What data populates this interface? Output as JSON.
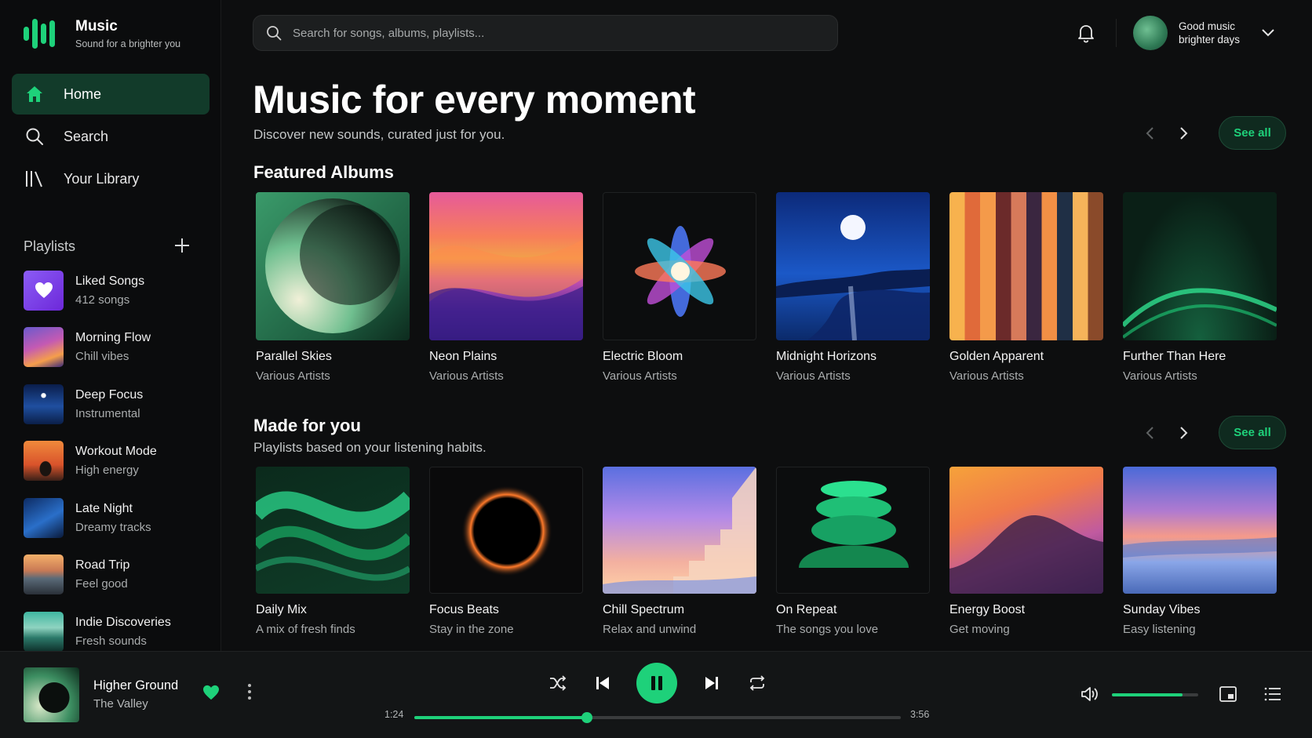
{
  "brand": {
    "name": "Music",
    "tagline": "Sound for a brighter you",
    "accent": "#1ed17a"
  },
  "nav": {
    "items": [
      {
        "label": "Home",
        "icon": "home-icon",
        "active": true
      },
      {
        "label": "Search",
        "icon": "search-icon",
        "active": false
      },
      {
        "label": "Your Library",
        "icon": "library-icon",
        "active": false
      }
    ]
  },
  "playlists": {
    "title": "Playlists",
    "items": [
      {
        "name": "Liked Songs",
        "sub": "412 songs"
      },
      {
        "name": "Morning Flow",
        "sub": "Chill vibes"
      },
      {
        "name": "Deep Focus",
        "sub": "Instrumental"
      },
      {
        "name": "Workout Mode",
        "sub": "High energy"
      },
      {
        "name": "Late Night",
        "sub": "Dreamy tracks"
      },
      {
        "name": "Road Trip",
        "sub": "Feel good"
      },
      {
        "name": "Indie Discoveries",
        "sub": "Fresh sounds"
      }
    ]
  },
  "search": {
    "placeholder": "Search for songs, albums, playlists..."
  },
  "user": {
    "line1": "Good music",
    "line2": "brighter days"
  },
  "hero": {
    "title": "Music for every moment",
    "subtitle": "Discover new sounds, curated just for you."
  },
  "featured": {
    "title": "Featured Albums",
    "see_all": "See all",
    "items": [
      {
        "title": "Parallel Skies",
        "sub": "Various Artists"
      },
      {
        "title": "Neon Plains",
        "sub": "Various Artists"
      },
      {
        "title": "Electric Bloom",
        "sub": "Various Artists"
      },
      {
        "title": "Midnight Horizons",
        "sub": "Various Artists"
      },
      {
        "title": "Golden Apparent",
        "sub": "Various Artists"
      },
      {
        "title": "Further Than Here",
        "sub": "Various Artists"
      }
    ]
  },
  "made_for_you": {
    "title": "Made for you",
    "subtitle": "Playlists based on your listening habits.",
    "see_all": "See all",
    "items": [
      {
        "title": "Daily Mix",
        "sub": "A mix of fresh finds"
      },
      {
        "title": "Focus Beats",
        "sub": "Stay in the zone"
      },
      {
        "title": "Chill Spectrum",
        "sub": "Relax and unwind"
      },
      {
        "title": "On Repeat",
        "sub": "The songs you love"
      },
      {
        "title": "Energy Boost",
        "sub": "Get moving"
      },
      {
        "title": "Sunday Vibes",
        "sub": "Easy listening"
      }
    ]
  },
  "player": {
    "title": "Higher Ground",
    "artist": "The Valley",
    "elapsed": "1:24",
    "duration": "3:56",
    "progress": 0.355,
    "volume": 0.82,
    "liked": true
  }
}
